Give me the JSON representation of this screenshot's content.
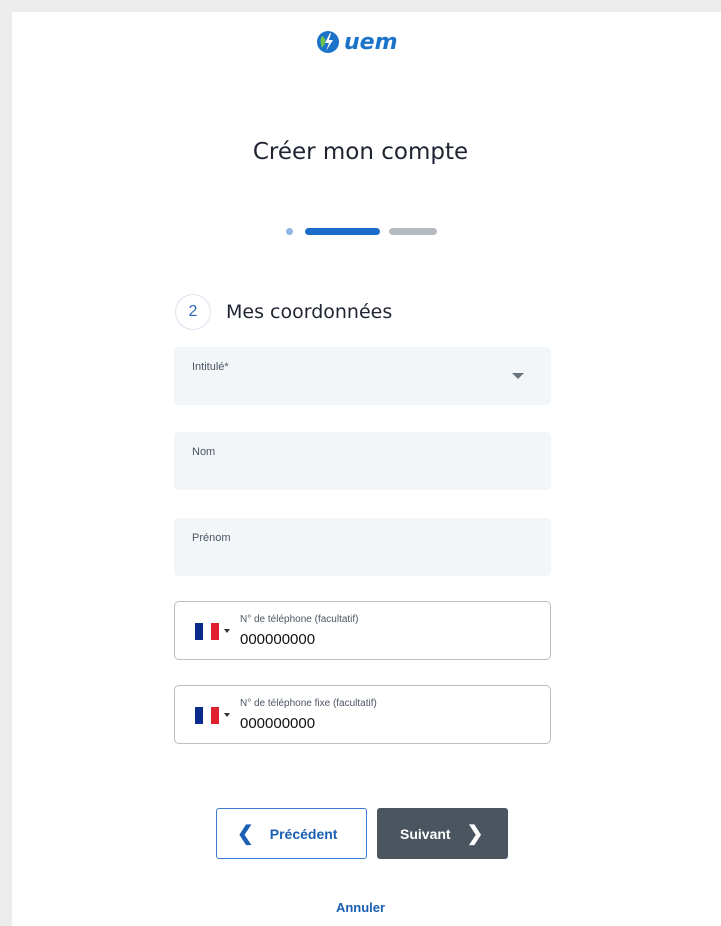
{
  "brand": {
    "name": "uem",
    "color": "#1a73c9"
  },
  "page": {
    "title": "Créer mon compte"
  },
  "stepper": {
    "current_step": 2,
    "total_steps": 3
  },
  "section": {
    "number": "2",
    "title": "Mes coordonnées"
  },
  "fields": {
    "intitule": {
      "label": "Intitulé*",
      "value": ""
    },
    "nom": {
      "label": "Nom",
      "value": ""
    },
    "prenom": {
      "label": "Prénom",
      "value": ""
    }
  },
  "phones": {
    "mobile": {
      "label": "N° de téléphone (facultatif)",
      "value": "000000000",
      "country": "FR"
    },
    "fixe": {
      "label": "N° de téléphone fixe (facultatif)",
      "value": "000000000",
      "country": "FR"
    }
  },
  "buttons": {
    "previous": "Précédent",
    "next": "Suivant",
    "cancel": "Annuler"
  },
  "icons": [
    "lightning-leaf-logo-icon",
    "chevron-down-icon",
    "chevron-left-icon",
    "chevron-right-icon",
    "france-flag-icon"
  ]
}
